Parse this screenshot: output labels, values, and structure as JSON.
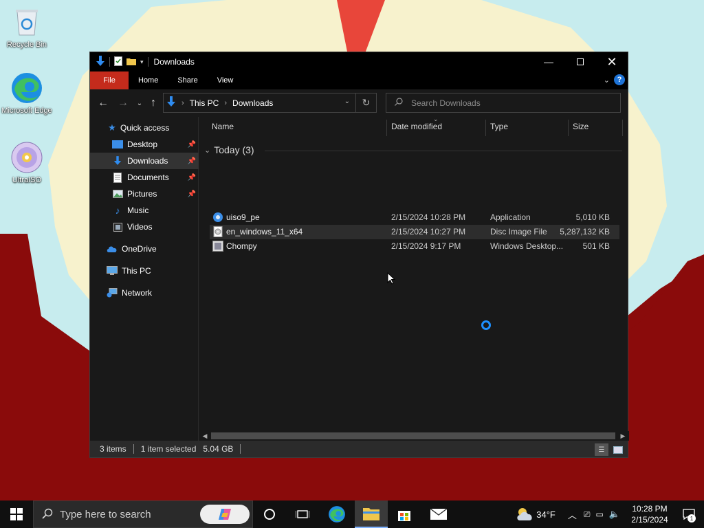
{
  "desktop": {
    "icons": [
      {
        "label": "Recycle Bin"
      },
      {
        "label": "Microsoft Edge"
      },
      {
        "label": "UltraISO"
      }
    ]
  },
  "window": {
    "title": "Downloads",
    "ribbon_tabs": [
      "File",
      "Home",
      "Share",
      "View"
    ],
    "address": {
      "crumbs": [
        "This PC",
        "Downloads"
      ]
    },
    "search": {
      "placeholder": "Search Downloads"
    },
    "nav": {
      "quick_access": "Quick access",
      "items": [
        {
          "label": "Desktop",
          "pinned": true
        },
        {
          "label": "Downloads",
          "pinned": true,
          "selected": true
        },
        {
          "label": "Documents",
          "pinned": true
        },
        {
          "label": "Pictures",
          "pinned": true
        },
        {
          "label": "Music",
          "pinned": false
        },
        {
          "label": "Videos",
          "pinned": false
        }
      ],
      "onedrive": "OneDrive",
      "thispc": "This PC",
      "network": "Network"
    },
    "columns": [
      "Name",
      "Date modified",
      "Type",
      "Size"
    ],
    "group_label": "Today (3)",
    "files": [
      {
        "name": "uiso9_pe",
        "date": "2/15/2024 10:28 PM",
        "type": "Application",
        "size": "5,010 KB",
        "icon": "app-icon"
      },
      {
        "name": "en_windows_11_x64",
        "date": "2/15/2024 10:27 PM",
        "type": "Disc Image File",
        "size": "5,287,132 KB",
        "icon": "disc-image-icon",
        "selected": true
      },
      {
        "name": "Chompy",
        "date": "2/15/2024 9:17 PM",
        "type": "Windows Desktop...",
        "size": "501 KB",
        "icon": "theme-file-icon"
      }
    ],
    "status": {
      "items": "3 items",
      "selected": "1 item selected",
      "size": "5.04 GB"
    }
  },
  "taskbar": {
    "search_placeholder": "Type here to search",
    "weather": "34°F",
    "time": "10:28 PM",
    "date": "2/15/2024",
    "notification_count": "1"
  },
  "colors": {
    "accent": "#c42b1c",
    "wallpaper_red": "#8a0b0b",
    "wallpaper_cream": "#f6f1c8",
    "link_blue": "#1e73d6"
  }
}
